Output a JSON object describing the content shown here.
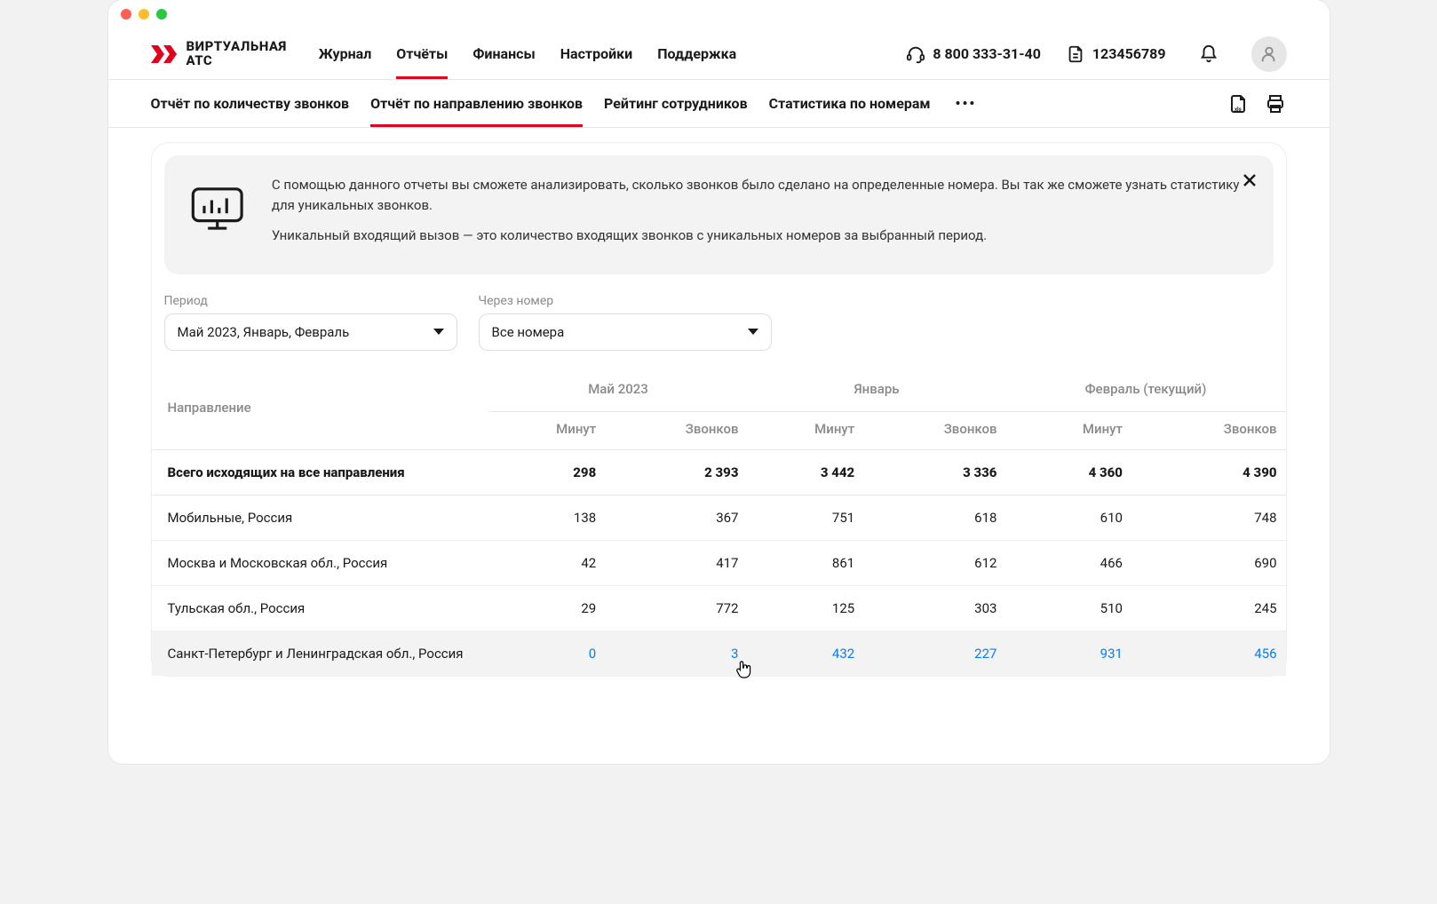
{
  "brand": {
    "line1": "ВИРТУАЛЬНАЯ",
    "line2": "АТС"
  },
  "nav": [
    "Журнал",
    "Отчёты",
    "Финансы",
    "Настройки",
    "Поддержка"
  ],
  "nav_active_index": 1,
  "header": {
    "phone": "8 800 333-31-40",
    "account_id": "123456789"
  },
  "subtabs": [
    "Отчёт по количеству звонков",
    "Отчёт по направлению звонков",
    "Рейтинг сотрудников",
    "Статистика по номерам"
  ],
  "subtab_active_index": 1,
  "banner": {
    "p1": "С помощью данного отчеты вы сможете анализировать, сколько звонков было сделано на определенные номера. Вы так же сможете узнать статистику для уникальных звонков.",
    "p2": "Уникальный входящий вызов — это количество входящих звонков с уникальных номеров за выбранный период."
  },
  "filters": {
    "period_label": "Период",
    "period_value": "Май 2023, Январь, Февраль",
    "via_label": "Через номер",
    "via_value": "Все номера"
  },
  "table": {
    "dir_header": "Направление",
    "periods": [
      "Май 2023",
      "Январь",
      "Февраль (текущий)"
    ],
    "sub_headers": [
      "Минут",
      "Звонков"
    ],
    "total_label": "Всего исходящих на все направления",
    "total": [
      "298",
      "2 393",
      "3 442",
      "3 336",
      "4 360",
      "4 390"
    ],
    "rows": [
      {
        "dir": "Мобильные, Россия",
        "vals": [
          "138",
          "367",
          "751",
          "618",
          "610",
          "748"
        ]
      },
      {
        "dir": "Москва и Московская обл., Россия",
        "vals": [
          "42",
          "417",
          "861",
          "612",
          "466",
          "690"
        ]
      },
      {
        "dir": "Тульская обл., Россия",
        "vals": [
          "29",
          "772",
          "125",
          "303",
          "510",
          "245"
        ]
      },
      {
        "dir": "Санкт-Петербург и Ленинградская обл., Россия",
        "vals": [
          "0",
          "3",
          "432",
          "227",
          "931",
          "456"
        ]
      }
    ],
    "hover_row_index": 3
  }
}
